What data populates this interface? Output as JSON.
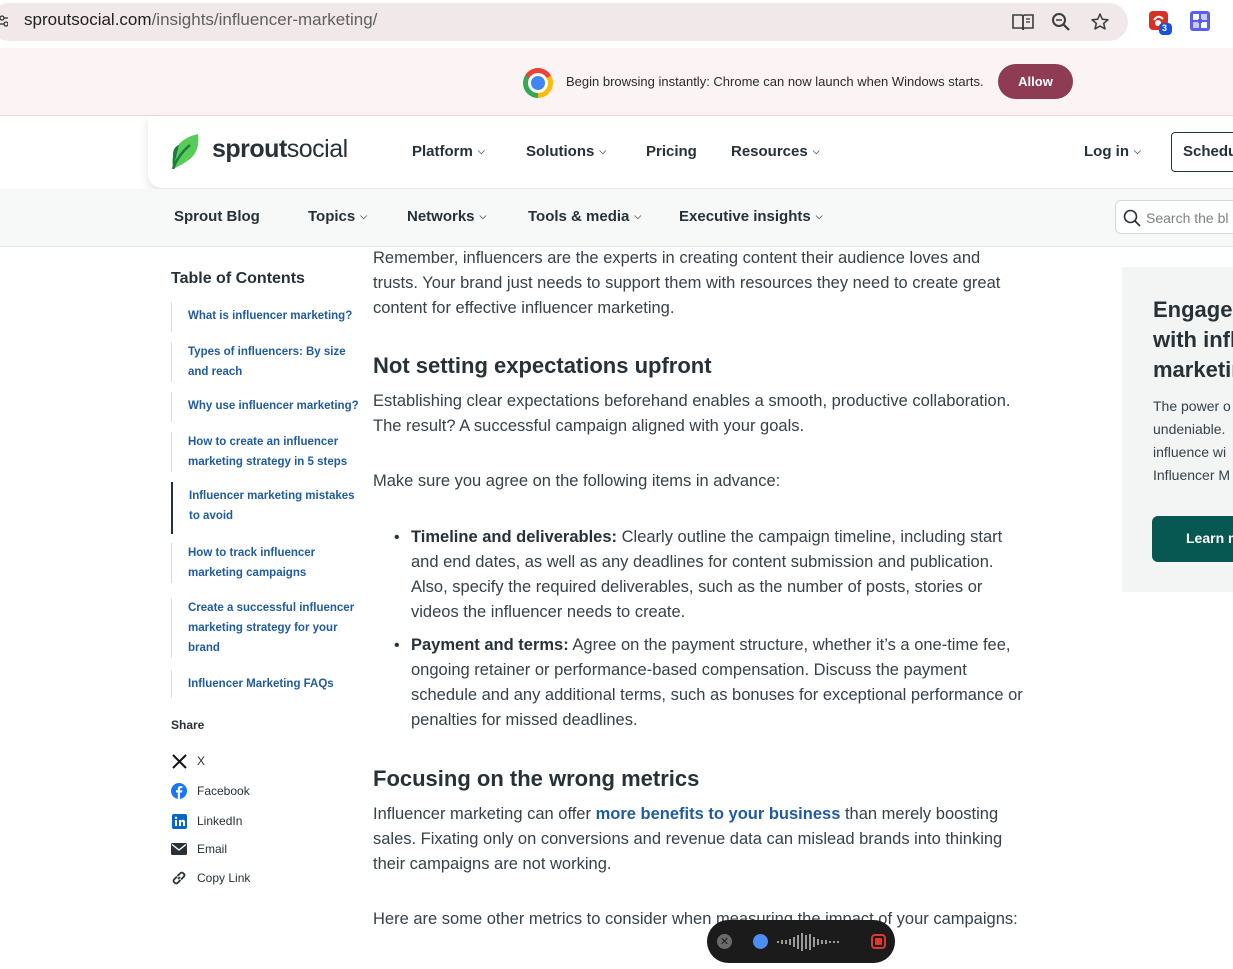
{
  "browser": {
    "url_host": "sproutsocial.com",
    "url_path": "/insights/influencer-marketing/",
    "extension_badge": "3"
  },
  "infobar": {
    "message": "Begin browsing instantly: Chrome can now launch when Windows starts.",
    "allow_label": "Allow"
  },
  "nav": {
    "logo_bold": "sprout",
    "logo_light": "social",
    "items": [
      {
        "label": "Platform",
        "has_caret": true
      },
      {
        "label": "Solutions",
        "has_caret": true
      },
      {
        "label": "Pricing",
        "has_caret": false
      },
      {
        "label": "Resources",
        "has_caret": true
      }
    ],
    "login_label": "Log in",
    "schedule_label": "Schedu"
  },
  "subnav": {
    "items": [
      {
        "label": "Sprout Blog",
        "has_caret": false
      },
      {
        "label": "Topics",
        "has_caret": true
      },
      {
        "label": "Networks",
        "has_caret": true
      },
      {
        "label": "Tools & media",
        "has_caret": true
      },
      {
        "label": "Executive insights",
        "has_caret": true
      }
    ],
    "search_placeholder": "Search the bl"
  },
  "toc": {
    "title": "Table of Contents",
    "items": [
      {
        "label": "What is influencer marketing?",
        "active": false
      },
      {
        "label": "Types of influencers: By size and reach",
        "active": false
      },
      {
        "label": "Why use influencer marketing?",
        "active": false
      },
      {
        "label": "How to create an influencer marketing strategy in 5 steps",
        "active": false
      },
      {
        "label": "Influencer marketing mistakes to avoid",
        "active": true
      },
      {
        "label": "How to track influencer marketing campaigns",
        "active": false
      },
      {
        "label": "Create a successful influencer marketing strategy for your brand",
        "active": false
      },
      {
        "label": "Influencer Marketing FAQs",
        "active": false
      }
    ]
  },
  "share": {
    "title": "Share",
    "items": [
      {
        "label": "X",
        "icon": "x-icon"
      },
      {
        "label": "Facebook",
        "icon": "facebook-icon"
      },
      {
        "label": "LinkedIn",
        "icon": "linkedin-icon"
      },
      {
        "label": "Email",
        "icon": "email-icon"
      },
      {
        "label": "Copy Link",
        "icon": "link-icon"
      }
    ]
  },
  "article": {
    "intro": "Remember, influencers are the experts in creating content their audience loves and trusts. Your brand just needs to support them with resources they need to create great content for effective influencer marketing.",
    "h_expectations": "Not setting expectations upfront",
    "p_expectations": "Establishing clear expectations beforehand enables a smooth, productive collaboration. The result? A successful campaign aligned with your goals.",
    "p_agree": "Make sure you agree on the following items in advance:",
    "bullets": [
      {
        "bold": "Timeline and deliverables:",
        "text": " Clearly outline the campaign timeline, including start and end dates, as well as any deadlines for content submission and publication. Also, specify the required deliverables, such as the number of posts, stories or videos the influencer needs to create."
      },
      {
        "bold": "Payment and terms:",
        "text": " Agree on the payment structure, whether it’s a one-time fee, ongoing retainer or performance-based compensation. Discuss the payment schedule and any additional terms, such as bonuses for exceptional performance or penalties for missed deadlines."
      }
    ],
    "h_metrics": "Focusing on the wrong metrics",
    "p_metrics_before": "Influencer marketing can offer ",
    "p_metrics_link": "more benefits to your business",
    "p_metrics_after": " than merely boosting sales. Fixating only on conversions and revenue data can mislead brands into thinking their campaigns are not working.",
    "p_other": "Here are some other metrics to consider when measuring the impact of your campaigns:"
  },
  "promo": {
    "title_lines": [
      "Engage",
      "with infl",
      "marketin"
    ],
    "text_lines": [
      "The power o",
      "undeniable.",
      "influence wi",
      "Influencer M"
    ],
    "button_label": "Learn m"
  },
  "colors": {
    "link": "#1f5b9e",
    "allow_button": "#8e3c54",
    "promo_button": "#075752",
    "logo_green": "#59cb59"
  }
}
